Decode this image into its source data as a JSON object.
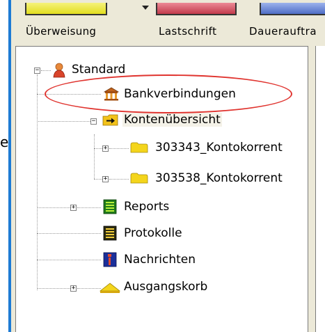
{
  "toolbar": {
    "buttons": [
      {
        "label": "Überweisung",
        "color": "#e8e43a"
      },
      {
        "label": "Lastschrift",
        "color": "#d24a5a"
      },
      {
        "label": "Dauerauftra",
        "color": "#6480d6"
      }
    ]
  },
  "left_edge_char": "e",
  "tree": {
    "root": {
      "label": "Standard",
      "icon": "person-icon",
      "expanded": true
    },
    "items": [
      {
        "label": "Bankverbindungen",
        "icon": "bank-icon"
      },
      {
        "label": "Kontenübersicht",
        "icon": "arrow-folder-icon",
        "expanded": true
      },
      {
        "label": "303343_Kontokorrent",
        "icon": "folder-icon",
        "expanded": false
      },
      {
        "label": "303538_Kontokorrent",
        "icon": "folder-icon",
        "expanded": false
      },
      {
        "label": "Reports",
        "icon": "reports-icon",
        "expanded": false
      },
      {
        "label": "Protokolle",
        "icon": "protocol-icon"
      },
      {
        "label": "Nachrichten",
        "icon": "messages-icon"
      },
      {
        "label": "Ausgangskorb",
        "icon": "outbox-icon",
        "expanded": false
      }
    ]
  },
  "colors": {
    "frame_blue": "#1e7bd4",
    "highlight_red": "#e0342f"
  }
}
